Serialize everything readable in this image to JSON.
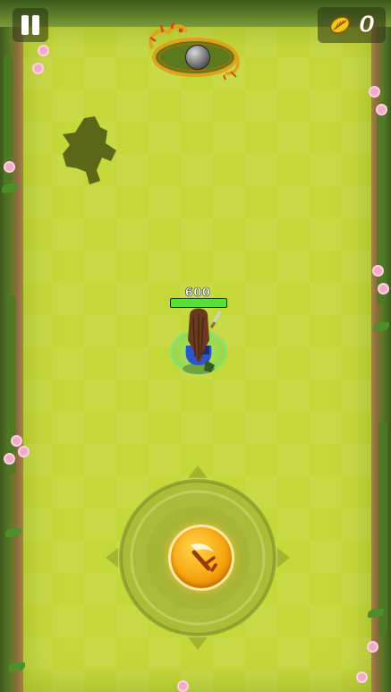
{
  "hud": {
    "pause_icon": "pause-icon",
    "coin_icon": "gold-leaf-coin-icon",
    "coins": "0"
  },
  "boss_indicator": {
    "icon": "dragon-frame-icon",
    "orb": "iron-orb-icon"
  },
  "player": {
    "hp": "600",
    "hp_fraction": 1.0
  },
  "joystick": {
    "icon": "sword-slash-icon"
  },
  "colors": {
    "field": "#c5d83a",
    "hp_fill": "#57e03a",
    "joystick_knob": "#f7a50e",
    "flower": "#f4a9c8"
  }
}
